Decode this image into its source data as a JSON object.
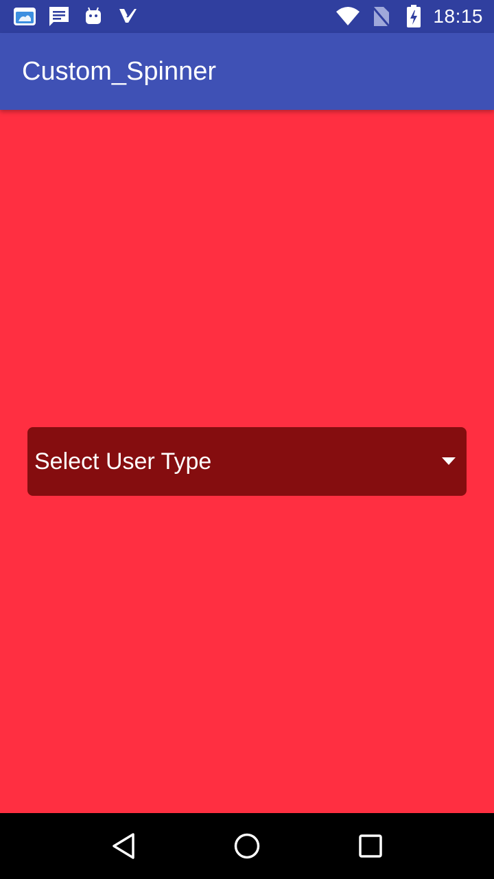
{
  "status_bar": {
    "time": "18:15",
    "left_icons": [
      "file-manager-icon",
      "message-icon",
      "android-icon",
      "checkmark-app-icon"
    ],
    "right_icons": [
      "wifi-icon",
      "no-sim-icon",
      "battery-charging-icon"
    ]
  },
  "app_bar": {
    "title": "Custom_Spinner"
  },
  "spinner": {
    "selected_label": "Select User Type",
    "arrow_icon": "dropdown-arrow-icon"
  },
  "nav_bar": {
    "buttons": [
      "back-icon",
      "home-icon",
      "recents-icon"
    ]
  },
  "colors": {
    "status_bar": "#303F9F",
    "app_bar": "#3F51B5",
    "background": "#FF2F41",
    "spinner": "#850D0F",
    "nav_bar": "#000000"
  }
}
